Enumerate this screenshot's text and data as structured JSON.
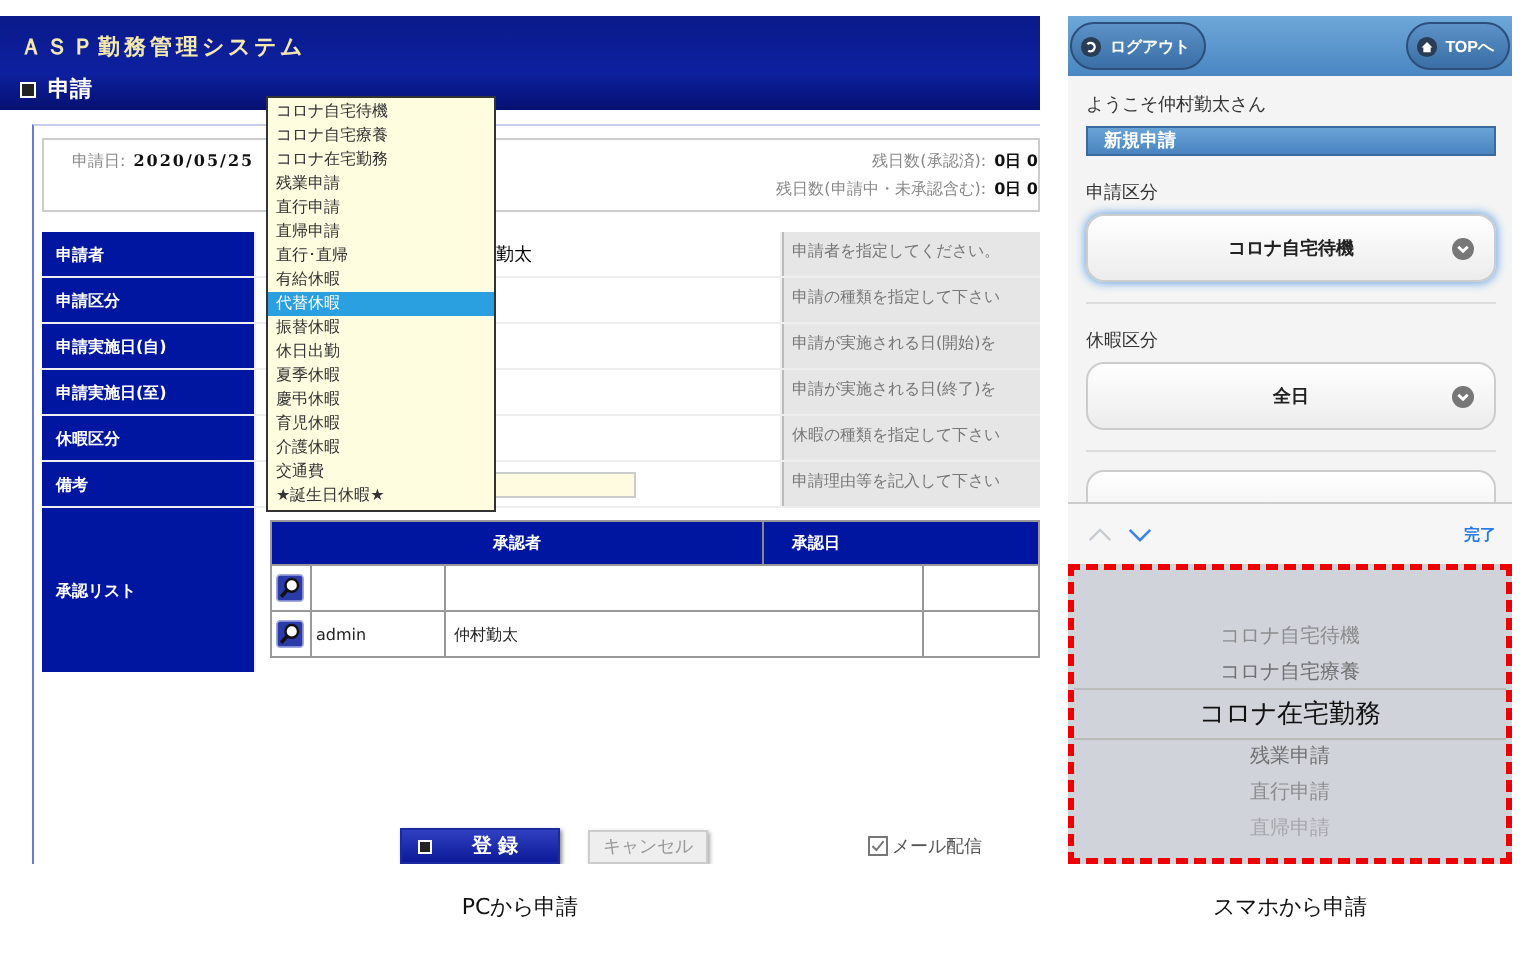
{
  "pc": {
    "app_title": "ＡＳＰ勤務管理システム",
    "section": "申請",
    "apply_date_label": "申請日:",
    "apply_date": "2020/05/25",
    "remaining": [
      {
        "label": "残日数(承認済):",
        "value": "0日 0"
      },
      {
        "label": "残日数(申請中・未承認含む):",
        "value": "0日 0"
      }
    ],
    "form_rows": [
      {
        "label": "申請者",
        "value": "勤太",
        "kind": "text",
        "hint": "申請者を指定してください。"
      },
      {
        "label": "申請区分",
        "kind": "none",
        "hint": "申請の種類を指定して下さい"
      },
      {
        "label": "申請実施日(自)",
        "kind": "none",
        "hint": "申請が実施される日(開始)を"
      },
      {
        "label": "申請実施日(至)",
        "kind": "none",
        "hint": "申請が実施される日(終了)を"
      },
      {
        "label": "休暇区分",
        "kind": "none",
        "hint": "休暇の種類を指定して下さい"
      },
      {
        "label": "備考",
        "kind": "input",
        "hint": "申請理由等を記入して下さい"
      }
    ],
    "approval": {
      "label": "承認リスト",
      "columns": [
        "承認者",
        "承認日"
      ],
      "rows": [
        {
          "id": "",
          "name": ""
        },
        {
          "id": "admin",
          "name": "仲村勤太"
        }
      ]
    },
    "dropdown": [
      {
        "label": "コロナ自宅待機",
        "selected": false
      },
      {
        "label": "コロナ自宅療養",
        "selected": false
      },
      {
        "label": "コロナ在宅勤務",
        "selected": false
      },
      {
        "label": "残業申請",
        "selected": false
      },
      {
        "label": "直行申請",
        "selected": false
      },
      {
        "label": "直帰申請",
        "selected": false
      },
      {
        "label": "直行･直帰",
        "selected": false
      },
      {
        "label": "有給休暇",
        "selected": false
      },
      {
        "label": "代替休暇",
        "selected": true
      },
      {
        "label": "振替休暇",
        "selected": false
      },
      {
        "label": "休日出勤",
        "selected": false
      },
      {
        "label": "夏季休暇",
        "selected": false
      },
      {
        "label": "慶弔休暇",
        "selected": false
      },
      {
        "label": "育児休暇",
        "selected": false
      },
      {
        "label": "介護休暇",
        "selected": false
      },
      {
        "label": "交通費",
        "selected": false
      },
      {
        "label": "★誕生日休暇★",
        "selected": false
      }
    ],
    "register": "登 録",
    "cancel": "キャンセル",
    "mail": {
      "label": "メール配信",
      "checked": true
    },
    "caption": "PCから申請"
  },
  "mobile": {
    "logout": "ログアウト",
    "top": "TOPへ",
    "welcome": "ようこそ仲村勤太さん",
    "heading": "新規申請",
    "fields": [
      {
        "label": "申請区分",
        "value": "コロナ自宅待機",
        "focused": true
      },
      {
        "label": "休暇区分",
        "value": "全日",
        "focused": false
      }
    ],
    "done": "完了",
    "picker": [
      {
        "label": "コロナ自宅待機",
        "selected": false
      },
      {
        "label": "コロナ自宅療養",
        "selected": false
      },
      {
        "label": "コロナ在宅勤務",
        "selected": true
      },
      {
        "label": "残業申請",
        "selected": false
      },
      {
        "label": "直行申請",
        "selected": false
      },
      {
        "label": "直帰申請",
        "selected": false
      }
    ],
    "caption": "スマホから申請"
  }
}
